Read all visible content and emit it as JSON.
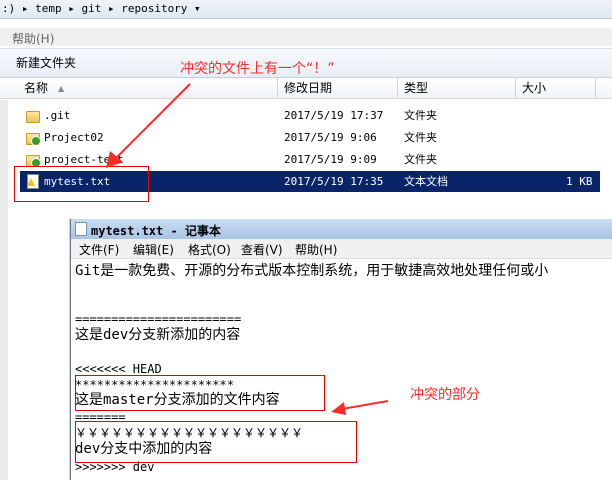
{
  "explorer": {
    "address_path": ":) ▸ temp ▸ git ▸ repository ▾",
    "menu": {
      "help": "帮助(H)"
    },
    "toolbar": {
      "new_folder": "新建文件夹"
    },
    "columns": {
      "name": "名称",
      "date": "修改日期",
      "type": "类型",
      "size": "大小"
    },
    "files": [
      {
        "name": ".git",
        "date": "2017/5/19 17:37",
        "type": "文件夹",
        "size": "",
        "icon": "folder-icon"
      },
      {
        "name": "Project02",
        "date": "2017/5/19 9:06",
        "type": "文件夹",
        "size": "",
        "icon": "folder-synced-icon"
      },
      {
        "name": "project-test",
        "date": "2017/5/19 9:09",
        "type": "文件夹",
        "size": "",
        "icon": "folder-synced-icon"
      },
      {
        "name": "mytest.txt",
        "date": "2017/5/19 17:35",
        "type": "文本文档",
        "size": "1 KB",
        "icon": "text-file-conflict-icon",
        "selected": true
      }
    ]
  },
  "annotations": {
    "conflict_file": "冲突的文件上有一个“！”",
    "conflict_part": "冲突的部分",
    "color": "#ff2a2a"
  },
  "notepad": {
    "title": "mytest.txt - 记事本",
    "menu": [
      "文件(F)",
      "编辑(E)",
      "格式(O)",
      "查看(V)",
      "帮助(H)"
    ],
    "lines": [
      "Git是一款免费、开源的分布式版本控制系统，用于敏捷高效地处理任何或小",
      "",
      "=======================",
      "这是dev分支新添加的内容",
      "",
      "<<<<<<< HEAD",
      "**********************",
      "这是master分支添加的文件内容",
      "=======",
      "￥￥￥￥￥￥￥￥￥￥￥￥￥￥￥￥￥￥￥",
      "dev分支中添加的内容",
      ">>>>>>> dev"
    ]
  }
}
